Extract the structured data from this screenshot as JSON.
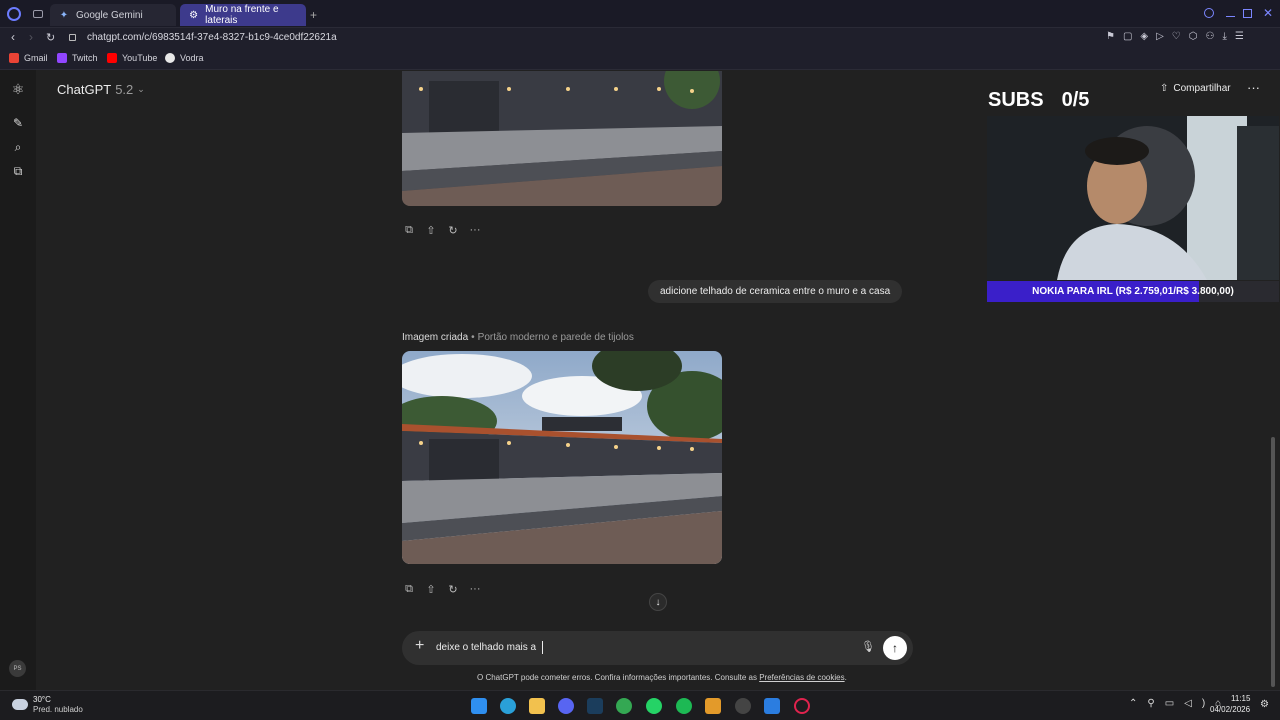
{
  "browser": {
    "tabs": [
      {
        "label": "Google Gemini",
        "active": false
      },
      {
        "label": "Muro na frente e laterais",
        "active": true
      }
    ],
    "url": "chatgpt.com/c/6983514f-37e4-8327-b1c9-4ce0df22621a",
    "bookmarks": [
      "Gmail",
      "Twitch",
      "YouTube",
      "Vodra"
    ]
  },
  "app": {
    "model_label": "ChatGPT",
    "model_version": "5.2",
    "share_label": "Compartilhar"
  },
  "chat": {
    "user_message": "adicione telhado de ceramica entre o muro e a casa",
    "image_created_label": "Imagem criada",
    "image_created_separator": "•",
    "image_title": "Portão moderno e parede de tijolos",
    "composer_value": "deixe o telhado mais a",
    "disclaimer_prefix": "O ChatGPT pode cometer erros. Confira informações importantes. Consulte as ",
    "disclaimer_link": "Preferências de cookies",
    "disclaimer_suffix": "."
  },
  "overlay": {
    "subs_label": "SUBS",
    "subs_count": "0/5",
    "banner": "NOKIA PARA IRL (R$ 2.759,01/R$ 3.800,00)",
    "goal_progress": 0.726
  },
  "user_avatar_initials": "PS",
  "taskbar": {
    "temp": "30°C",
    "weather": "Pred. nublado",
    "time": "11:15",
    "date": "04/02/2026"
  },
  "colors": {
    "bg": "#212121",
    "rail": "#1b1b1b",
    "composer": "#303030",
    "banner": "#3a1fc9",
    "accent_tab": "#3d3a8c"
  }
}
